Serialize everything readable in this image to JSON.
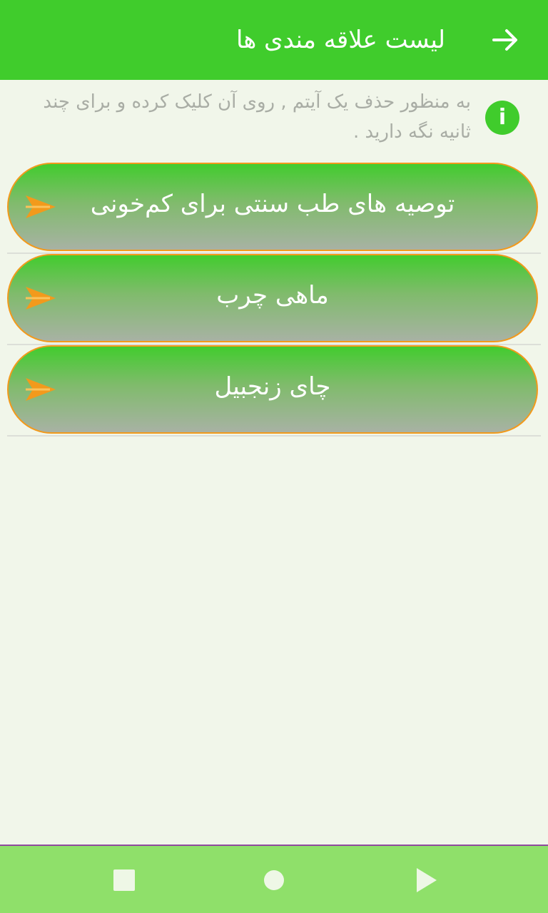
{
  "appbar": {
    "title": "لیست علاقه مندی ها",
    "back_icon": "arrow-right-icon"
  },
  "info": {
    "icon": "info-icon",
    "icon_glyph": "i",
    "text": "به منظور حذف یک آیتم , روی آن کلیک کرده و برای چند ثانیه نگه دارید ."
  },
  "favorites": [
    {
      "label": "توصیه های طب سنتی برای کم‌خونی"
    },
    {
      "label": "ماهی چرب"
    },
    {
      "label": "چای زنجبیل"
    }
  ],
  "colors": {
    "accent": "#40cc2c",
    "arrow": "#f29a1c",
    "navbar": "#8fe06a"
  },
  "navbar": {
    "buttons": [
      "recent-apps-icon",
      "home-icon",
      "back-triangle-icon"
    ]
  }
}
